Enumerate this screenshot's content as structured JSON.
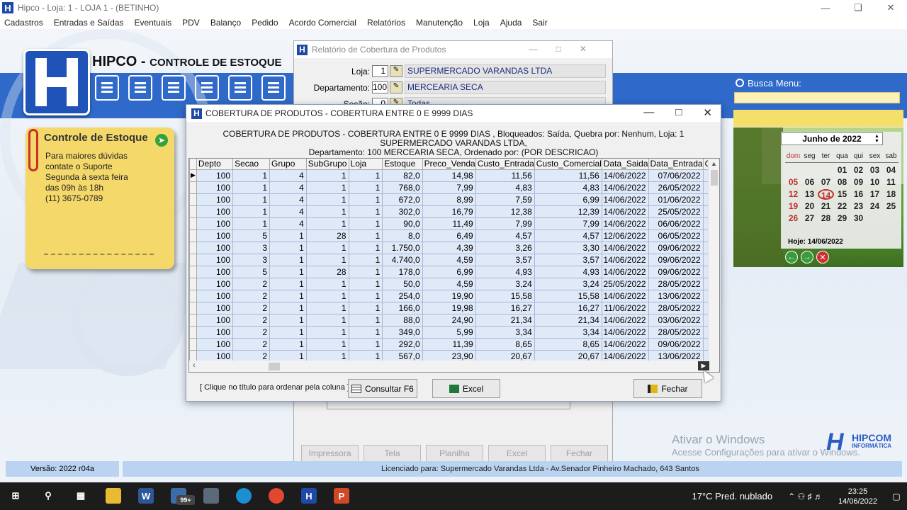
{
  "app_title": "Hipco - Loja: 1 - LOJA 1 - (BETINHO)",
  "menu": [
    "Cadastros",
    "Entradas e Saídas",
    "Eventuais",
    "PDV",
    "Balanço",
    "Pedido",
    "Acordo Comercial",
    "Relatórios",
    "Manutenção",
    "Loja",
    "Ajuda",
    "Sair"
  ],
  "brand": {
    "title": "HIPCO -",
    "subtitle": "CONTROLE DE ESTOQUE"
  },
  "note": {
    "title": "Controle de Estoque",
    "lines": [
      "Para maiores dúvidas",
      "contate o Suporte",
      "Segunda à sexta feira",
      "das 09h às 18h",
      "(11) 3675-0789"
    ]
  },
  "busca": {
    "label": "Busca Menu:",
    "value": ""
  },
  "calendar": {
    "month_year": "Junho de 2022",
    "weekdays": [
      "dom",
      "seg",
      "ter",
      "qua",
      "qui",
      "sex",
      "sab"
    ],
    "weeks": [
      [
        "",
        "",
        "",
        "01",
        "02",
        "03",
        "04"
      ],
      [
        "05",
        "06",
        "07",
        "08",
        "09",
        "10",
        "11"
      ],
      [
        "12",
        "13",
        "14",
        "15",
        "16",
        "17",
        "18"
      ],
      [
        "19",
        "20",
        "21",
        "22",
        "23",
        "24",
        "25"
      ],
      [
        "26",
        "27",
        "28",
        "29",
        "30",
        "",
        ""
      ]
    ],
    "today_day": "14",
    "today_label": "Hoje: 14/06/2022"
  },
  "report_window": {
    "title": "Relatório de Cobertura de Produtos",
    "loja_label": "Loja:",
    "loja_code": "1",
    "loja_desc": "SUPERMERCADO VARANDAS LTDA",
    "depto_label": "Departamento:",
    "depto_code": "100",
    "depto_desc": "MERCEARIA SECA",
    "secao_label": "Seção:",
    "secao_code": "0",
    "secao_desc": "Todas",
    "buttons": [
      "Impressora",
      "Tela",
      "Planilha",
      "Excel",
      "Fechar"
    ]
  },
  "grid_window": {
    "title": "COBERTURA DE PRODUTOS - COBERTURA ENTRE 0 E 9999 DIAS",
    "header_line1": "COBERTURA DE PRODUTOS - COBERTURA ENTRE 0 E 9999 DIAS , Bloqueados: Saída, Quebra por: Nenhum, Loja: 1 SUPERMERCADO VARANDAS LTDA,",
    "header_line2": "Departamento: 100 MERCEARIA SECA, Ordenado por:  (POR DESCRICAO)",
    "columns": [
      "Depto",
      "Secao",
      "Grupo",
      "SubGrupo",
      "Loja",
      "Estoque",
      "Preco_Venda",
      "Custo_Entrada",
      "Custo_Comercial",
      "Data_Saida",
      "Data_Entrada",
      "Qtd"
    ],
    "rows": [
      [
        "100",
        "1",
        "4",
        "1",
        "1",
        "82,0",
        "14,98",
        "11,56",
        "11,56",
        "14/06/2022",
        "07/06/2022"
      ],
      [
        "100",
        "1",
        "4",
        "1",
        "1",
        "768,0",
        "7,99",
        "4,83",
        "4,83",
        "14/06/2022",
        "26/05/2022"
      ],
      [
        "100",
        "1",
        "4",
        "1",
        "1",
        "672,0",
        "8,99",
        "7,59",
        "6,99",
        "14/06/2022",
        "01/06/2022"
      ],
      [
        "100",
        "1",
        "4",
        "1",
        "1",
        "302,0",
        "16,79",
        "12,38",
        "12,39",
        "14/06/2022",
        "25/05/2022"
      ],
      [
        "100",
        "1",
        "4",
        "1",
        "1",
        "90,0",
        "11,49",
        "7,99",
        "7,99",
        "14/06/2022",
        "06/06/2022"
      ],
      [
        "100",
        "5",
        "1",
        "28",
        "1",
        "8,0",
        "6,49",
        "4,57",
        "4,57",
        "12/06/2022",
        "06/05/2022"
      ],
      [
        "100",
        "3",
        "1",
        "1",
        "1",
        "1.750,0",
        "4,39",
        "3,26",
        "3,30",
        "14/06/2022",
        "09/06/2022"
      ],
      [
        "100",
        "3",
        "1",
        "1",
        "1",
        "4.740,0",
        "4,59",
        "3,57",
        "3,57",
        "14/06/2022",
        "09/06/2022"
      ],
      [
        "100",
        "5",
        "1",
        "28",
        "1",
        "178,0",
        "6,99",
        "4,93",
        "4,93",
        "14/06/2022",
        "09/06/2022"
      ],
      [
        "100",
        "2",
        "1",
        "1",
        "1",
        "50,0",
        "4,59",
        "3,24",
        "3,24",
        "25/05/2022",
        "28/05/2022"
      ],
      [
        "100",
        "2",
        "1",
        "1",
        "1",
        "254,0",
        "19,90",
        "15,58",
        "15,58",
        "14/06/2022",
        "13/06/2022"
      ],
      [
        "100",
        "2",
        "1",
        "1",
        "1",
        "166,0",
        "19,98",
        "16,27",
        "16,27",
        "11/06/2022",
        "28/05/2022"
      ],
      [
        "100",
        "2",
        "1",
        "1",
        "1",
        "88,0",
        "24,90",
        "21,34",
        "21,34",
        "14/06/2022",
        "03/06/2022"
      ],
      [
        "100",
        "2",
        "1",
        "1",
        "1",
        "349,0",
        "5,99",
        "3,34",
        "3,34",
        "14/06/2022",
        "28/05/2022"
      ],
      [
        "100",
        "2",
        "1",
        "1",
        "1",
        "292,0",
        "11,39",
        "8,65",
        "8,65",
        "14/06/2022",
        "09/06/2022"
      ],
      [
        "100",
        "2",
        "1",
        "1",
        "1",
        "567,0",
        "23,90",
        "20,67",
        "20,67",
        "14/06/2022",
        "13/06/2022"
      ]
    ],
    "hint": "[ Clique no título para ordenar pela coluna ]",
    "btn_consultar": "Consultar F6",
    "btn_excel": "Excel",
    "btn_fechar": "Fechar"
  },
  "status": {
    "versao": "Versão: 2022 r04a",
    "licenciado": "Licenciado para: Supermercado Varandas Ltda   -   Av.Senador Pinheiro Machado, 643 Santos"
  },
  "watermark": {
    "line1": "Ativar o Windows",
    "line2": "Acesse Configurações para ativar o Windows."
  },
  "hipcom": {
    "name": "HIPCOM",
    "sub": "INFORMÁTICA"
  },
  "taskbar": {
    "badge": "99+",
    "weather": "17°C  Pred. nublado",
    "time": "23:25",
    "date": "14/06/2022"
  },
  "colors": {
    "accent_blue": "#2f69c9",
    "note_yellow": "#f4d86a",
    "grid_row": "#dfe9f8"
  }
}
